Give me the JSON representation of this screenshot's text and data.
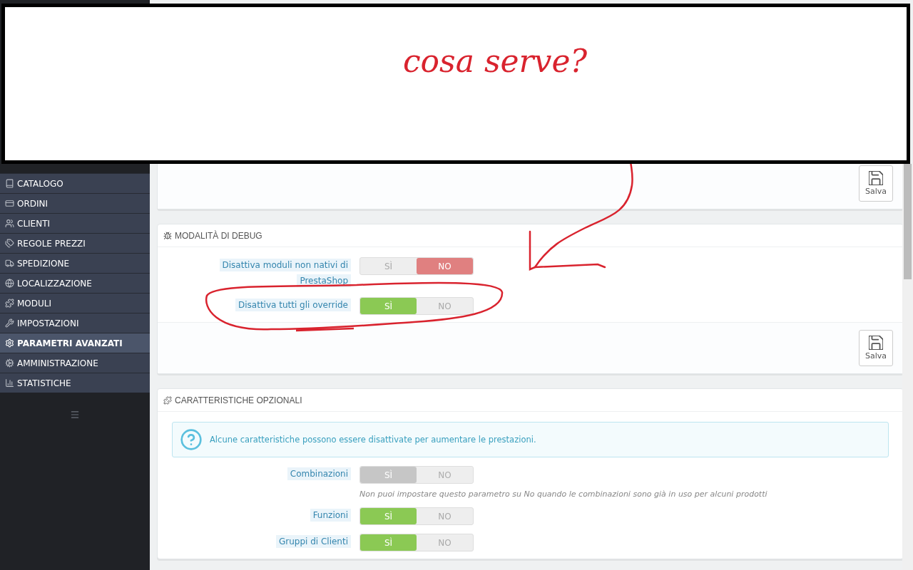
{
  "sidebar": {
    "items": [
      {
        "label": "CATALOGO",
        "selected": false
      },
      {
        "label": "ORDINI",
        "selected": false
      },
      {
        "label": "CLIENTI",
        "selected": false
      },
      {
        "label": "REGOLE PREZZI",
        "selected": false
      },
      {
        "label": "SPEDIZIONE",
        "selected": false
      },
      {
        "label": "LOCALIZZAZIONE",
        "selected": false
      },
      {
        "label": "MODULI",
        "selected": false
      },
      {
        "label": "IMPOSTAZIONI",
        "selected": false
      },
      {
        "label": "PARAMETRI AVANZATI",
        "selected": true
      },
      {
        "label": "AMMINISTRAZIONE",
        "selected": false
      },
      {
        "label": "STATISTICHE",
        "selected": false
      }
    ]
  },
  "panels": [
    {
      "save_button": "Salva"
    },
    {
      "title": "MODALITÀ DI DEBUG",
      "fields": [
        {
          "label": "Disattiva moduli non nativi di PrestaShop",
          "disabled": false,
          "options": [
            {
              "label": "SÌ",
              "selected": false
            },
            {
              "label": "NO",
              "selected": true
            }
          ]
        },
        {
          "label": "Disattiva tutti gli override",
          "disabled": false,
          "options": [
            {
              "label": "SÌ",
              "selected": true
            },
            {
              "label": "NO",
              "selected": false
            }
          ]
        }
      ],
      "save_button": "Salva"
    },
    {
      "title": "CARATTERISTICHE OPZIONALI",
      "alert": "Alcune caratteristiche possono essere disattivate per aumentare le prestazioni.",
      "fields": [
        {
          "label": "Combinazioni",
          "disabled": true,
          "options": [
            {
              "label": "SÌ",
              "selected": true
            },
            {
              "label": "NO",
              "selected": false
            }
          ],
          "help": "Non puoi impostare questo parametro su No quando le combinazioni sono già in uso per alcuni prodotti"
        },
        {
          "label": "Funzioni",
          "disabled": false,
          "options": [
            {
              "label": "SÌ",
              "selected": true
            },
            {
              "label": "NO",
              "selected": false
            }
          ]
        },
        {
          "label": "Gruppi di Clienti",
          "disabled": false,
          "options": [
            {
              "label": "SÌ",
              "selected": true
            },
            {
              "label": "NO",
              "selected": false
            }
          ]
        }
      ]
    }
  ],
  "annotation": {
    "text": "cosa serve?"
  }
}
